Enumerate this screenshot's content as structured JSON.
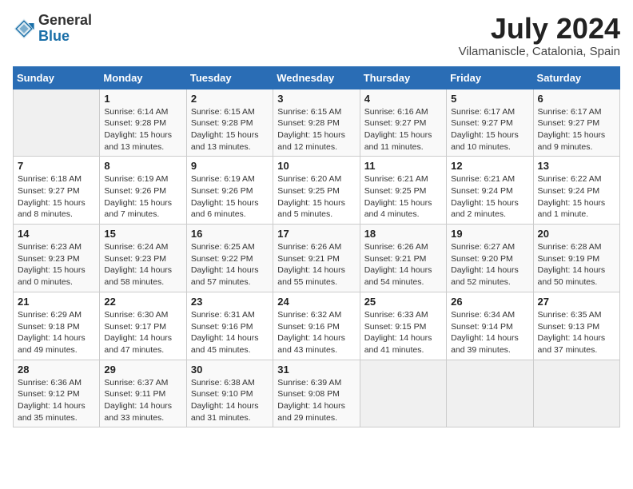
{
  "header": {
    "logo_general": "General",
    "logo_blue": "Blue",
    "month_year": "July 2024",
    "location": "Vilamaniscle, Catalonia, Spain"
  },
  "weekdays": [
    "Sunday",
    "Monday",
    "Tuesday",
    "Wednesday",
    "Thursday",
    "Friday",
    "Saturday"
  ],
  "weeks": [
    [
      {
        "day": "",
        "data": ""
      },
      {
        "day": "1",
        "data": "Sunrise: 6:14 AM\nSunset: 9:28 PM\nDaylight: 15 hours\nand 13 minutes."
      },
      {
        "day": "2",
        "data": "Sunrise: 6:15 AM\nSunset: 9:28 PM\nDaylight: 15 hours\nand 13 minutes."
      },
      {
        "day": "3",
        "data": "Sunrise: 6:15 AM\nSunset: 9:28 PM\nDaylight: 15 hours\nand 12 minutes."
      },
      {
        "day": "4",
        "data": "Sunrise: 6:16 AM\nSunset: 9:27 PM\nDaylight: 15 hours\nand 11 minutes."
      },
      {
        "day": "5",
        "data": "Sunrise: 6:17 AM\nSunset: 9:27 PM\nDaylight: 15 hours\nand 10 minutes."
      },
      {
        "day": "6",
        "data": "Sunrise: 6:17 AM\nSunset: 9:27 PM\nDaylight: 15 hours\nand 9 minutes."
      }
    ],
    [
      {
        "day": "7",
        "data": "Sunrise: 6:18 AM\nSunset: 9:27 PM\nDaylight: 15 hours\nand 8 minutes."
      },
      {
        "day": "8",
        "data": "Sunrise: 6:19 AM\nSunset: 9:26 PM\nDaylight: 15 hours\nand 7 minutes."
      },
      {
        "day": "9",
        "data": "Sunrise: 6:19 AM\nSunset: 9:26 PM\nDaylight: 15 hours\nand 6 minutes."
      },
      {
        "day": "10",
        "data": "Sunrise: 6:20 AM\nSunset: 9:25 PM\nDaylight: 15 hours\nand 5 minutes."
      },
      {
        "day": "11",
        "data": "Sunrise: 6:21 AM\nSunset: 9:25 PM\nDaylight: 15 hours\nand 4 minutes."
      },
      {
        "day": "12",
        "data": "Sunrise: 6:21 AM\nSunset: 9:24 PM\nDaylight: 15 hours\nand 2 minutes."
      },
      {
        "day": "13",
        "data": "Sunrise: 6:22 AM\nSunset: 9:24 PM\nDaylight: 15 hours\nand 1 minute."
      }
    ],
    [
      {
        "day": "14",
        "data": "Sunrise: 6:23 AM\nSunset: 9:23 PM\nDaylight: 15 hours\nand 0 minutes."
      },
      {
        "day": "15",
        "data": "Sunrise: 6:24 AM\nSunset: 9:23 PM\nDaylight: 14 hours\nand 58 minutes."
      },
      {
        "day": "16",
        "data": "Sunrise: 6:25 AM\nSunset: 9:22 PM\nDaylight: 14 hours\nand 57 minutes."
      },
      {
        "day": "17",
        "data": "Sunrise: 6:26 AM\nSunset: 9:21 PM\nDaylight: 14 hours\nand 55 minutes."
      },
      {
        "day": "18",
        "data": "Sunrise: 6:26 AM\nSunset: 9:21 PM\nDaylight: 14 hours\nand 54 minutes."
      },
      {
        "day": "19",
        "data": "Sunrise: 6:27 AM\nSunset: 9:20 PM\nDaylight: 14 hours\nand 52 minutes."
      },
      {
        "day": "20",
        "data": "Sunrise: 6:28 AM\nSunset: 9:19 PM\nDaylight: 14 hours\nand 50 minutes."
      }
    ],
    [
      {
        "day": "21",
        "data": "Sunrise: 6:29 AM\nSunset: 9:18 PM\nDaylight: 14 hours\nand 49 minutes."
      },
      {
        "day": "22",
        "data": "Sunrise: 6:30 AM\nSunset: 9:17 PM\nDaylight: 14 hours\nand 47 minutes."
      },
      {
        "day": "23",
        "data": "Sunrise: 6:31 AM\nSunset: 9:16 PM\nDaylight: 14 hours\nand 45 minutes."
      },
      {
        "day": "24",
        "data": "Sunrise: 6:32 AM\nSunset: 9:16 PM\nDaylight: 14 hours\nand 43 minutes."
      },
      {
        "day": "25",
        "data": "Sunrise: 6:33 AM\nSunset: 9:15 PM\nDaylight: 14 hours\nand 41 minutes."
      },
      {
        "day": "26",
        "data": "Sunrise: 6:34 AM\nSunset: 9:14 PM\nDaylight: 14 hours\nand 39 minutes."
      },
      {
        "day": "27",
        "data": "Sunrise: 6:35 AM\nSunset: 9:13 PM\nDaylight: 14 hours\nand 37 minutes."
      }
    ],
    [
      {
        "day": "28",
        "data": "Sunrise: 6:36 AM\nSunset: 9:12 PM\nDaylight: 14 hours\nand 35 minutes."
      },
      {
        "day": "29",
        "data": "Sunrise: 6:37 AM\nSunset: 9:11 PM\nDaylight: 14 hours\nand 33 minutes."
      },
      {
        "day": "30",
        "data": "Sunrise: 6:38 AM\nSunset: 9:10 PM\nDaylight: 14 hours\nand 31 minutes."
      },
      {
        "day": "31",
        "data": "Sunrise: 6:39 AM\nSunset: 9:08 PM\nDaylight: 14 hours\nand 29 minutes."
      },
      {
        "day": "",
        "data": ""
      },
      {
        "day": "",
        "data": ""
      },
      {
        "day": "",
        "data": ""
      }
    ]
  ]
}
